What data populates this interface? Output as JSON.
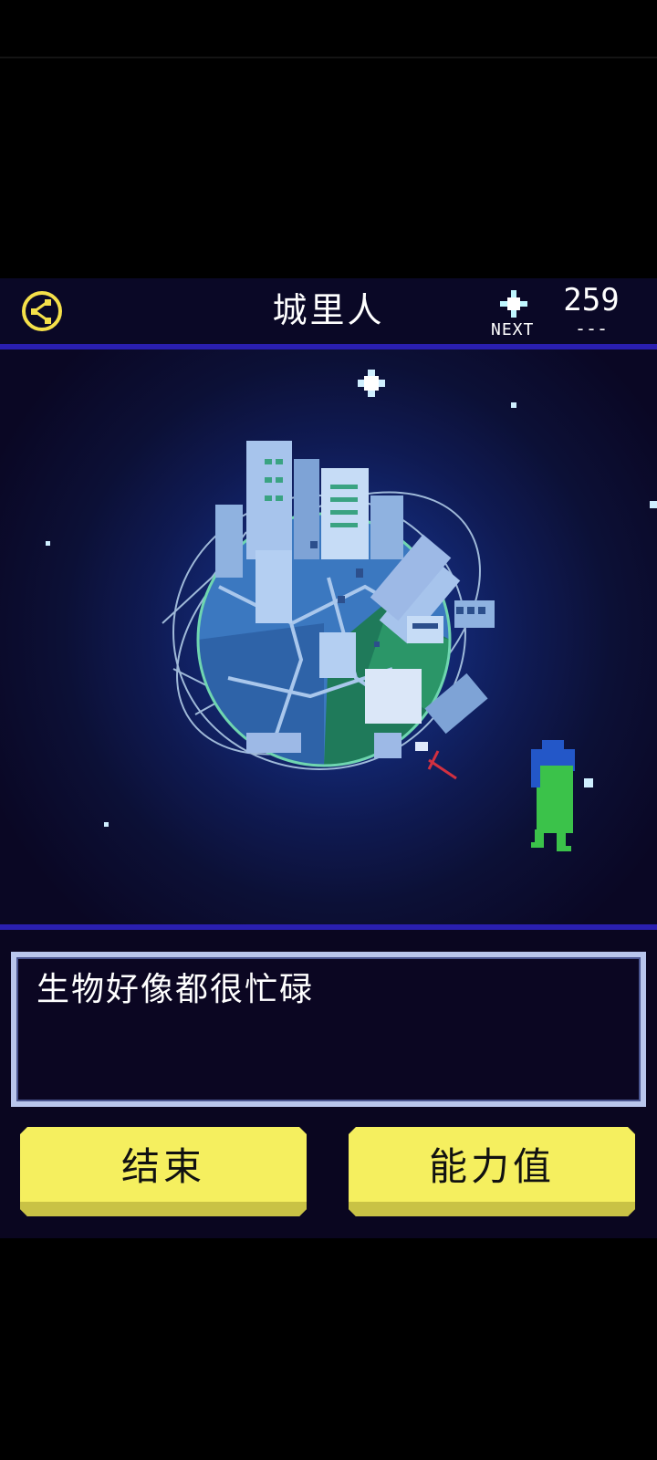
{
  "topbar": {
    "title": "城里人",
    "next_label": "NEXT",
    "count": "259",
    "count_sub": "---"
  },
  "dialog": {
    "message": "生物好像都很忙碌"
  },
  "buttons": {
    "end_label": "结束",
    "stats_label": "能力值"
  },
  "colors": {
    "button_yellow": "#f5ef5f",
    "divider_blue": "#2a1fb0",
    "dialog_border": "#b9c6ec",
    "share_icon": "#f5e04a",
    "creature_green": "#3bc24a",
    "creature_blue": "#2357c8"
  },
  "icons": [
    "share-icon",
    "sparkle-icon",
    "planet-city-illustration",
    "alien-creature"
  ]
}
